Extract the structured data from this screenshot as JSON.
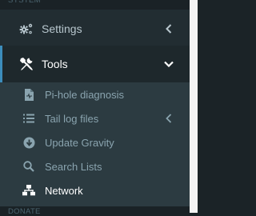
{
  "sections": {
    "system_label": "SYSTEM",
    "donate_label": "DONATE"
  },
  "menu": {
    "settings": {
      "label": "Settings",
      "icon": "cogs-icon",
      "expanded": false
    },
    "tools": {
      "label": "Tools",
      "icon": "wrench-screwdriver-icon",
      "expanded": true,
      "children": [
        {
          "label": "Pi-hole diagnosis",
          "icon": "file-medical-icon"
        },
        {
          "label": "Tail log files",
          "icon": "list-icon",
          "has_children": true
        },
        {
          "label": "Update Gravity",
          "icon": "arrow-circle-down-icon"
        },
        {
          "label": "Search Lists",
          "icon": "search-icon"
        },
        {
          "label": "Network",
          "icon": "network-icon",
          "active": true
        }
      ]
    }
  },
  "colors": {
    "sidebar_bg": "#222d32",
    "submenu_bg": "#2c3b41",
    "active_bg": "#1e282c",
    "accent": "#3c8dbc",
    "text": "#b8c7ce",
    "subtext": "#8aa4af",
    "active_text": "#ffffff"
  }
}
